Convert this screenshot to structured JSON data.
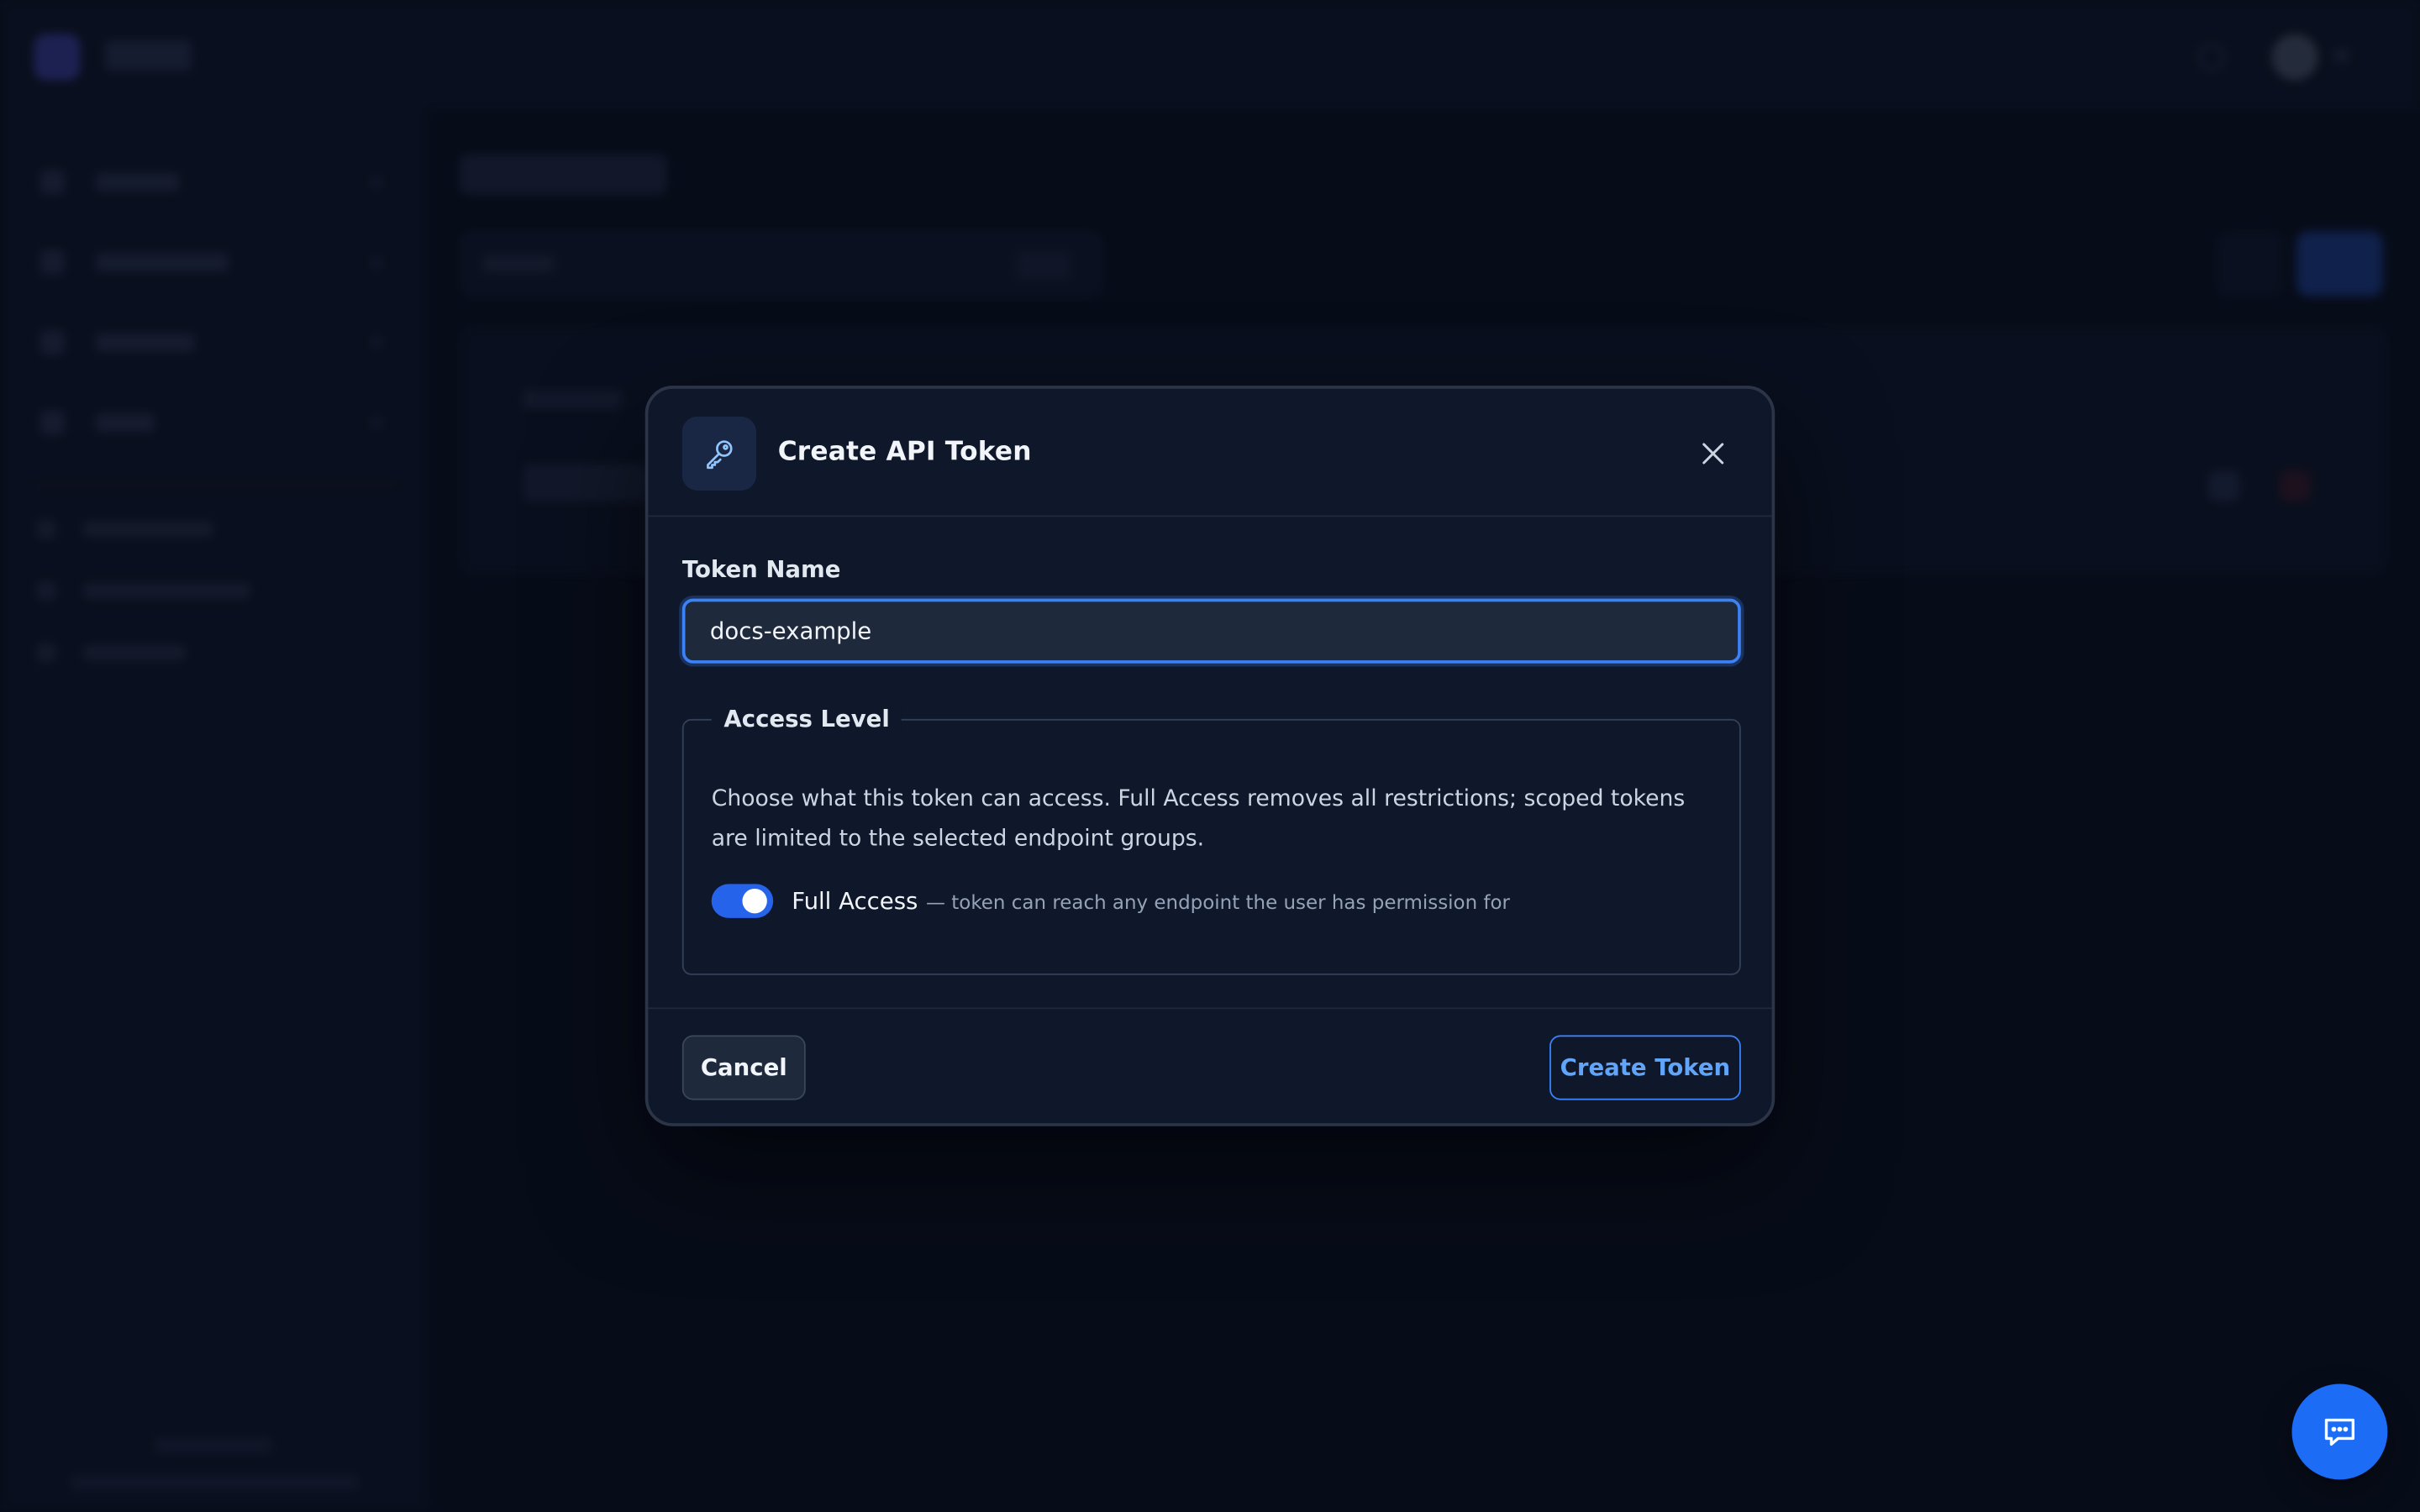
{
  "dialog": {
    "title": "Create API Token",
    "icon": "key-icon",
    "close_icon": "close-icon"
  },
  "form": {
    "token_name_label": "Token Name",
    "token_name_value": "docs-example"
  },
  "access_level": {
    "legend": "Access Level",
    "description": "Choose what this token can access. Full Access removes all restrictions; scoped tokens are limited to the selected endpoint groups.",
    "toggle_label": "Full Access",
    "toggle_hint": "— token can reach any endpoint the user has permission for",
    "toggle_on": true
  },
  "footer": {
    "cancel_label": "Cancel",
    "create_label": "Create Token"
  },
  "chat": {
    "icon": "chat-icon"
  },
  "colors": {
    "accent": "#3b82f6",
    "toggle_on": "#2563eb",
    "fab": "#1d6cf5",
    "modal_bg": "#0f172a"
  }
}
